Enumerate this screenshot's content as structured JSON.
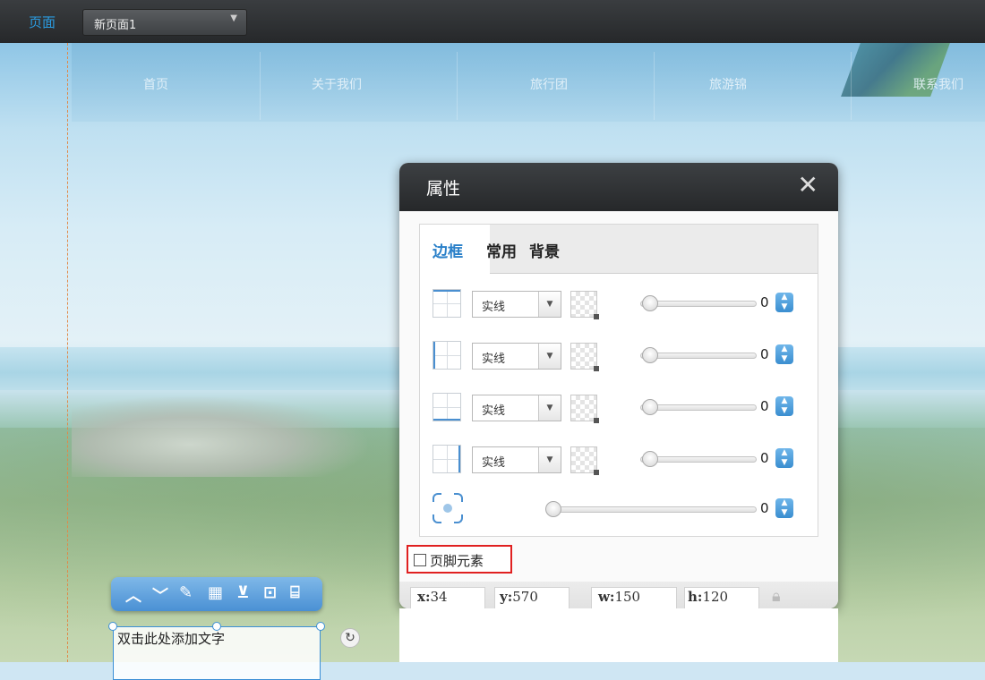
{
  "topbar": {
    "page_label": "页面",
    "page_select_value": "新页面1"
  },
  "site_nav": {
    "items": [
      "首页",
      "关于我们",
      "旅行团",
      "旅游锦",
      "联系我们"
    ]
  },
  "dialog": {
    "title": "属性",
    "tabs": [
      "边框",
      "常用",
      "背景"
    ],
    "active_tab": "边框",
    "border_rows": [
      {
        "side": "top",
        "style": "实线",
        "value": "0"
      },
      {
        "side": "left",
        "style": "实线",
        "value": "0"
      },
      {
        "side": "bottom",
        "style": "实线",
        "value": "0"
      },
      {
        "side": "right",
        "style": "实线",
        "value": "0"
      }
    ],
    "radius_value": "0",
    "footer_checkbox_label": "页脚元素",
    "footer_checkbox_checked": false,
    "coords": {
      "x_label": "x:",
      "x": "34",
      "y_label": "y:",
      "y": "570",
      "w_label": "w:",
      "w": "150",
      "h_label": "h:",
      "h": "120"
    }
  },
  "element_toolbar": {
    "icons": [
      "move-up-icon",
      "move-down-icon",
      "edit-icon",
      "layout-icon",
      "layer-icon",
      "unlock-icon",
      "delete-icon"
    ]
  },
  "textbox": {
    "placeholder_text": "双击此处添加文字"
  },
  "colors": {
    "accent": "#2a80c9",
    "toolbar_bg": "#2e3134",
    "highlight_red": "#e02020"
  }
}
